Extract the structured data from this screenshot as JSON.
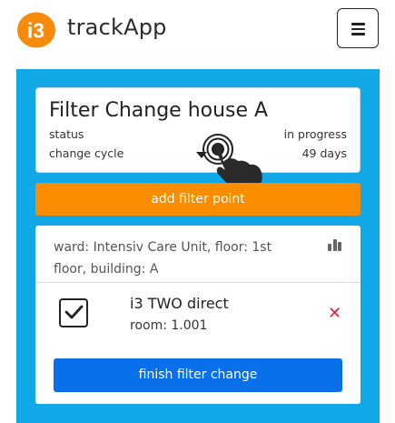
{
  "header": {
    "logo_text": "i3",
    "app_name": "trackApp",
    "menu_icon": "hamburger-menu-icon",
    "logo_color": "#f58a0b"
  },
  "filter_card": {
    "title": "Filter Change house A",
    "status_label": "status",
    "status_value": "in progress",
    "cycle_label": "change cycle",
    "cycle_value": "49 days"
  },
  "actions": {
    "add_filter_point": "add filter point",
    "finish_filter_change": "finish filter change"
  },
  "location": {
    "text": "ward: Intensiv Care Unit, floor: 1st floor, building: A",
    "chart_icon": "bar-chart-icon"
  },
  "filter_item": {
    "name": "i3 TWO direct",
    "room": "room: 1.001",
    "checked": true,
    "remove_icon": "close-icon"
  },
  "colors": {
    "panel": "#12a8e8",
    "orange_button": "#fa8c00",
    "blue_button": "#0a70ea",
    "remove": "#e0213a"
  }
}
